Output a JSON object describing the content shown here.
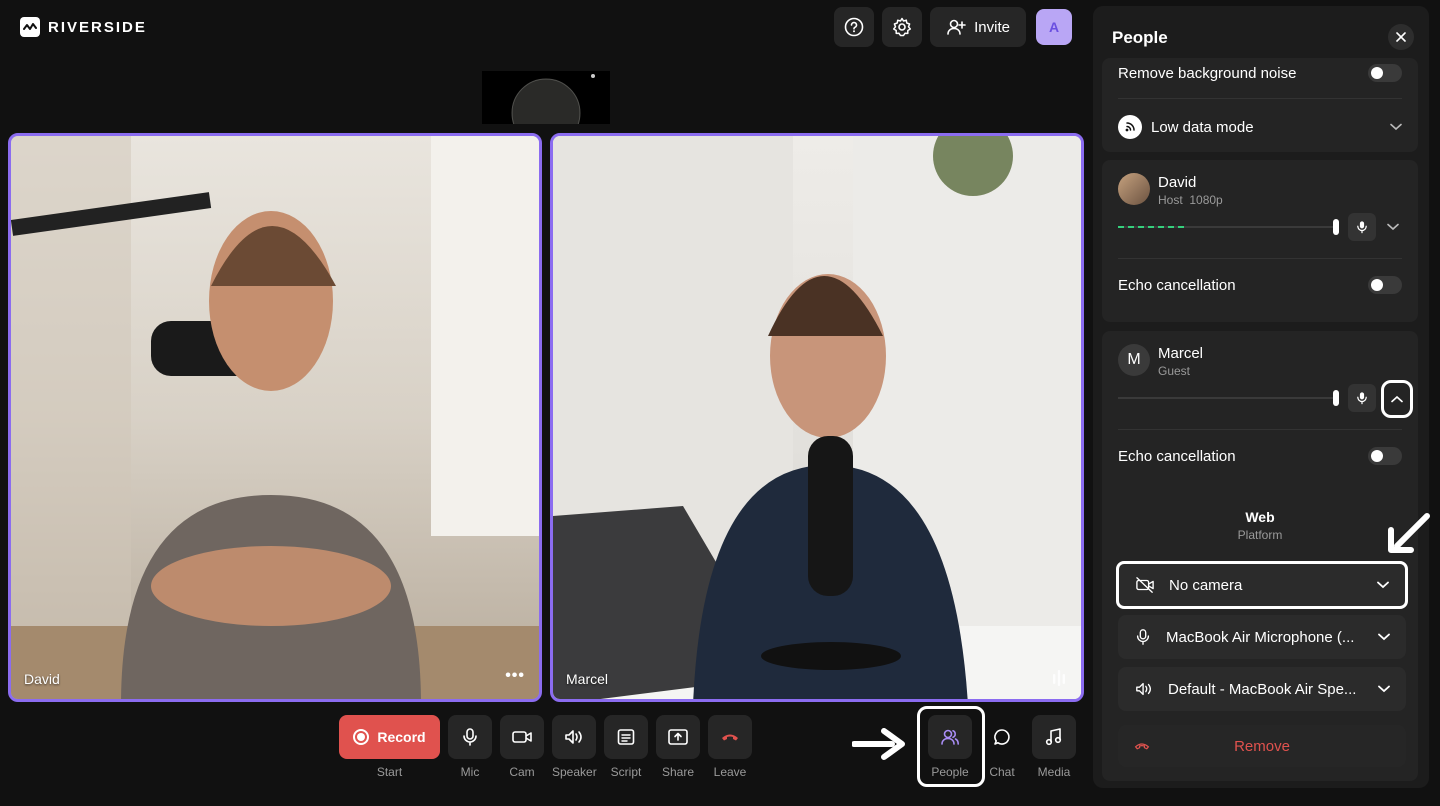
{
  "app": {
    "brand": "RIVERSIDE",
    "avatar_initial": "A"
  },
  "header": {
    "invite_label": "Invite",
    "help_icon": "help-icon",
    "settings_icon": "gear-icon"
  },
  "tiles": [
    {
      "name": "David"
    },
    {
      "name": "Marcel"
    }
  ],
  "toolbar": {
    "record_label": "Record",
    "record_sub": "Start",
    "mic": "Mic",
    "cam": "Cam",
    "speaker": "Speaker",
    "script": "Script",
    "share": "Share",
    "leave": "Leave",
    "people": "People",
    "chat": "Chat",
    "media": "Media"
  },
  "panel": {
    "title": "People",
    "remove_noise": "Remove background noise",
    "low_data": "Low data mode",
    "host": {
      "name": "David",
      "role": "Host",
      "resolution": "1080p",
      "echo": "Echo cancellation",
      "level": 0.3
    },
    "guest": {
      "initial": "M",
      "name": "Marcel",
      "role": "Guest",
      "echo": "Echo cancellation",
      "level": 0
    },
    "platform": {
      "name": "Web",
      "label": "Platform"
    },
    "camera": "No camera",
    "microphone": "MacBook Air Microphone (...",
    "speaker": "Default - MacBook Air Spe...",
    "remove": "Remove"
  },
  "colors": {
    "accent": "#8b6cf0",
    "record": "#e0524e",
    "level": "#34d07c"
  }
}
